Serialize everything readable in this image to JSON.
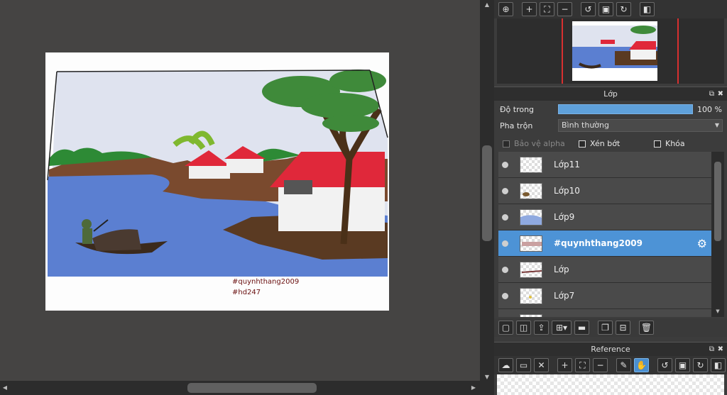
{
  "canvas": {
    "watermark_line1": "#quynhthang2009",
    "watermark_line2": "#hd247"
  },
  "navigator": {
    "toolbar_icons": [
      "zoom-fit-icon",
      "zoom-in-icon",
      "fit-window-icon",
      "zoom-out-icon",
      "rotate-left-icon",
      "reset-view-icon",
      "rotate-right-icon",
      "flip-icon"
    ]
  },
  "layers_panel": {
    "title": "Lớp",
    "opacity_label": "Độ trong",
    "opacity_value": "100 %",
    "opacity_fraction": 1.0,
    "blend_label": "Pha trộn",
    "blend_value": "Bình thường",
    "protect_alpha_label": "Bảo vệ alpha",
    "clipping_label": "Xén bớt",
    "lock_label": "Khóa",
    "layers": [
      {
        "name": "Lớp11",
        "selected": false
      },
      {
        "name": "Lớp10",
        "selected": false
      },
      {
        "name": "Lớp9",
        "selected": false
      },
      {
        "name": "#quynhthang2009",
        "selected": true
      },
      {
        "name": "Lớp",
        "selected": false
      },
      {
        "name": "Lớp7",
        "selected": false
      }
    ]
  },
  "reference_panel": {
    "title": "Reference"
  },
  "colors": {
    "accent": "#4d93d6",
    "roof": "#e0283a",
    "water": "#5b7fd1"
  }
}
